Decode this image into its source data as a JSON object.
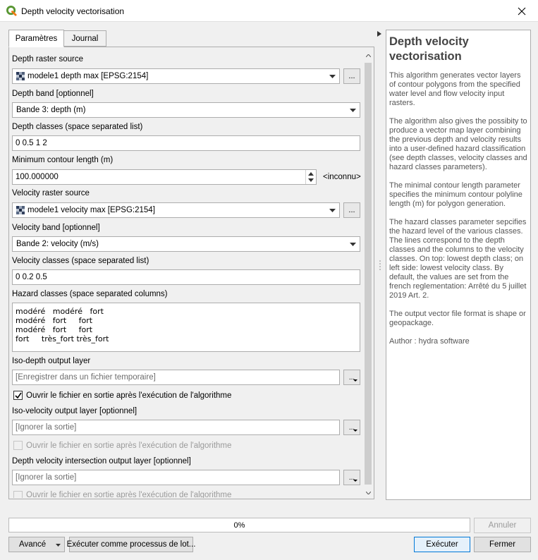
{
  "window": {
    "title": "Depth velocity vectorisation",
    "app_icon": "qgis-logo-icon",
    "close_icon": "close-icon"
  },
  "tabs": [
    {
      "label": "Paramètres",
      "active": true
    },
    {
      "label": "Journal",
      "active": false
    }
  ],
  "params": {
    "depth_raster_label": "Depth raster source",
    "depth_raster_value": "modele1 depth max [EPSG:2154]",
    "depth_band_label": "Depth band [optionnel]",
    "depth_band_value": "Bande 3: depth (m)",
    "depth_classes_label": "Depth classes (space separated list)",
    "depth_classes_value": "0 0.5 1 2",
    "min_contour_label": "Minimum contour length (m)",
    "min_contour_value": "100.000000",
    "min_contour_unit": "<inconnu>",
    "velocity_raster_label": "Velocity raster source",
    "velocity_raster_value": "modele1 velocity max [EPSG:2154]",
    "velocity_band_label": "Velocity band [optionnel]",
    "velocity_band_value": "Bande 2: velocity (m/s)",
    "velocity_classes_label": "Velocity classes (space separated list)",
    "velocity_classes_value": "0 0.2 0.5",
    "hazard_classes_label": "Hazard classes (space separated columns)",
    "hazard_rows": [
      "modéré   modéré   fort",
      "modéré   fort     fort",
      "modéré   fort     fort",
      "fort     très_fort très_fort"
    ],
    "iso_depth_label": "Iso-depth output layer",
    "iso_depth_placeholder": "[Enregistrer dans un fichier temporaire]",
    "iso_depth_open_label": "Ouvrir le fichier en sortie après l'exécution de l'algorithme",
    "iso_depth_open_checked": true,
    "iso_velocity_label": "Iso-velocity output layer [optionnel]",
    "iso_velocity_placeholder": "[Ignorer la sortie]",
    "iso_velocity_open_label": "Ouvrir le fichier en sortie après l'exécution de l'algorithme",
    "intersection_label": "Depth velocity intersection output layer [optionnel]",
    "intersection_placeholder": "[Ignorer la sortie]",
    "intersection_open_label": "Ouvrir le fichier en sortie après l'exécution de l'algorithme",
    "browse_label": "..."
  },
  "help": {
    "title": "Depth velocity vectorisation",
    "paragraphs": [
      "This algorithm generates vector layers of contour polygons from the specified water level and flow velocity input rasters.",
      "The algorithm also gives the possibity to produce a vector map layer combining the previous depth and velocity results into a user-defined hazard classification (see depth classes, velocity classes and hazard classes parameters).",
      "The minimal contour length parameter specifies the minimum contour polyline length (m) for polygon generation.",
      "The hazard classes parameter sepcifies the hazard level of the various classes. The lines correspond to the depth classes and the columns to the velocity classes. On top: lowest depth class; on left side: lowest velocity class. By default, the values are set from the french reglementation: Arrêté du 5 juillet 2019 Art. 2.",
      "The output vector file format is shape or geopackage.",
      "Author : hydra software"
    ]
  },
  "footer": {
    "progress_text": "0%",
    "progress_value": 0,
    "cancel_label": "Annuler",
    "advanced_label": "Avancé",
    "batch_label": "Exécuter comme processus de lot...",
    "run_label": "Exécuter",
    "close_label": "Fermer"
  },
  "colors": {
    "accent": "#0078d7",
    "qgis_green": "#589632",
    "qgis_yellow": "#ee7913"
  }
}
